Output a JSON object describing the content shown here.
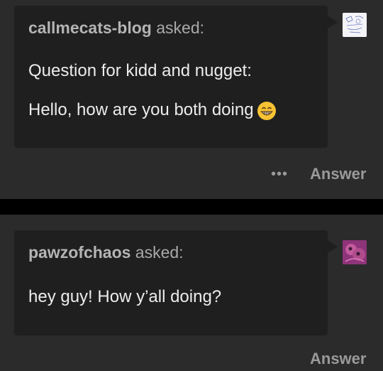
{
  "posts": [
    {
      "asker_name": "callmecats-blog",
      "asked_suffix": " asked:",
      "question_lines": [
        "Question for kidd and nugget:",
        "Hello, how are you both doing"
      ],
      "emoji": "grinning-face-with-smiling-eyes",
      "more_label": "•••",
      "answer_label": "Answer"
    },
    {
      "asker_name": "pawzofchaos",
      "asked_suffix": " asked:",
      "question_lines": [
        "hey guy! How y’all doing?"
      ],
      "answer_label": "Answer"
    }
  ],
  "colors": {
    "page_bg": "#000000",
    "card_bg": "#2b2b2b",
    "bubble_bg": "#1f1f1f",
    "text_primary": "#ececec",
    "text_secondary": "#a9a9a9"
  }
}
